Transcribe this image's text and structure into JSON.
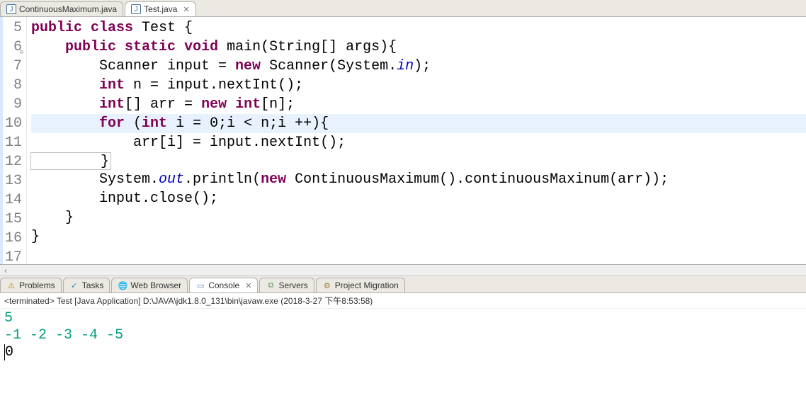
{
  "editor_tabs": [
    {
      "label": "ContinuousMaximum.java",
      "active": false
    },
    {
      "label": "Test.java",
      "active": true
    }
  ],
  "code": {
    "lines": [
      {
        "n": "5",
        "tokens": [
          [
            "kw",
            "public"
          ],
          [
            "plain",
            " "
          ],
          [
            "kw",
            "class"
          ],
          [
            "plain",
            " Test {"
          ]
        ]
      },
      {
        "n": "6",
        "implements": true,
        "tokens": [
          [
            "plain",
            "    "
          ],
          [
            "kw",
            "public"
          ],
          [
            "plain",
            " "
          ],
          [
            "kw",
            "static"
          ],
          [
            "plain",
            " "
          ],
          [
            "kw",
            "void"
          ],
          [
            "plain",
            " main(String[] args){"
          ]
        ]
      },
      {
        "n": "7",
        "tokens": [
          [
            "plain",
            "        Scanner input = "
          ],
          [
            "kw",
            "new"
          ],
          [
            "plain",
            " Scanner(System."
          ],
          [
            "it-static",
            "in"
          ],
          [
            "plain",
            ");"
          ]
        ]
      },
      {
        "n": "8",
        "tokens": [
          [
            "plain",
            "        "
          ],
          [
            "kw",
            "int"
          ],
          [
            "plain",
            " n = input.nextInt();"
          ]
        ]
      },
      {
        "n": "9",
        "tokens": [
          [
            "plain",
            "        "
          ],
          [
            "kw",
            "int"
          ],
          [
            "plain",
            "[] arr = "
          ],
          [
            "kw",
            "new"
          ],
          [
            "plain",
            " "
          ],
          [
            "kw",
            "int"
          ],
          [
            "plain",
            "[n];"
          ]
        ]
      },
      {
        "n": "10",
        "current": true,
        "tokens": [
          [
            "plain",
            "        "
          ],
          [
            "kw",
            "for"
          ],
          [
            "plain",
            " ("
          ],
          [
            "kw",
            "int"
          ],
          [
            "plain",
            " i = 0;i < n;i ++){"
          ]
        ]
      },
      {
        "n": "11",
        "tokens": [
          [
            "plain",
            "            arr[i] = input.nextInt();"
          ]
        ]
      },
      {
        "n": "12",
        "boxed": true,
        "tokens": [
          [
            "plain",
            "        }"
          ]
        ]
      },
      {
        "n": "13",
        "tokens": [
          [
            "plain",
            "        System."
          ],
          [
            "it-static",
            "out"
          ],
          [
            "plain",
            ".println("
          ],
          [
            "kw",
            "new"
          ],
          [
            "plain",
            " ContinuousMaximum().continuousMaxinum(arr));"
          ]
        ]
      },
      {
        "n": "14",
        "tokens": [
          [
            "plain",
            "        input.close();"
          ]
        ]
      },
      {
        "n": "15",
        "tokens": [
          [
            "plain",
            "    }"
          ]
        ]
      },
      {
        "n": "16",
        "tokens": [
          [
            "plain",
            "}"
          ]
        ]
      },
      {
        "n": "17",
        "tokens": [
          [
            "plain",
            ""
          ]
        ]
      }
    ]
  },
  "bottom_tabs": [
    {
      "label": "Problems",
      "icon": "⚠",
      "icon_color": "#c08000"
    },
    {
      "label": "Tasks",
      "icon": "✓",
      "icon_color": "#3080c0"
    },
    {
      "label": "Web Browser",
      "icon": "🌐",
      "icon_color": "#3080c0"
    },
    {
      "label": "Console",
      "icon": "▭",
      "icon_color": "#4060c0",
      "active": true
    },
    {
      "label": "Servers",
      "icon": "⧉",
      "icon_color": "#60a060"
    },
    {
      "label": "Project Migration",
      "icon": "⚙",
      "icon_color": "#a08040"
    }
  ],
  "console": {
    "status": "<terminated> Test [Java Application] D:\\JAVA\\jdk1.8.0_131\\bin\\javaw.exe (2018-3-27 下午8:53:58)",
    "input_lines": [
      "5",
      "-1 -2 -3 -4 -5"
    ],
    "output_lines": [
      "0"
    ]
  }
}
